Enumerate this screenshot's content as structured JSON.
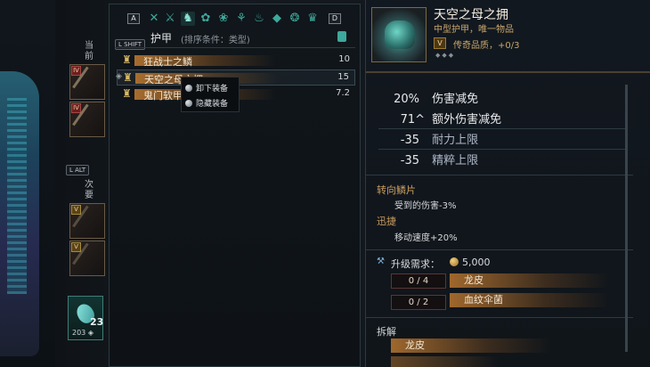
{
  "left": {
    "current_label": "当\n前",
    "secondary_label": "次\n要",
    "lalt": "L ALT",
    "current_slots": [
      {
        "rune": "IV"
      },
      {
        "rune": "IV"
      }
    ],
    "secondary_slots": [
      {
        "rune": "V"
      },
      {
        "rune": "V"
      }
    ],
    "potion_count": "23",
    "potion_sub": "203 ◈"
  },
  "list": {
    "tab_key_prev": "A",
    "tab_key_next": "D",
    "lshift": "L SHIFT",
    "section_title": "护甲",
    "sort_note": "(排序条件：类型)",
    "items": [
      {
        "name": "狂战士之鳞",
        "value": "10"
      },
      {
        "name": "天空之母之拥",
        "value": "15"
      },
      {
        "name": "鬼门软甲",
        "value": "7.2"
      }
    ],
    "context_menu": [
      "卸下装备",
      "隐藏装备"
    ]
  },
  "detail": {
    "title": "天空之母之拥",
    "subtitle": "中型护甲，唯一物品",
    "rarity_badge": "V",
    "rarity": "传奇品质，+0/3",
    "stats": [
      {
        "value": "20%",
        "label": "伤害减免"
      },
      {
        "value": "71^",
        "label": "额外伤害减免"
      },
      {
        "value": "-35",
        "label": "耐力上限"
      },
      {
        "value": "-35",
        "label": "精粹上限"
      }
    ],
    "perks": [
      {
        "name": "转向鳞片",
        "desc": "受到的伤害-3%"
      },
      {
        "name": "迅捷",
        "desc": "移动速度+20%"
      }
    ],
    "upgrade_label": "升级需求：",
    "upgrade_cost": "5,000",
    "materials": [
      {
        "count": "0 / 4",
        "name": "龙皮"
      },
      {
        "count": "0 / 2",
        "name": "血纹伞菌"
      }
    ],
    "dismantle_label": "拆解",
    "dismantle_items": [
      "龙皮"
    ]
  }
}
